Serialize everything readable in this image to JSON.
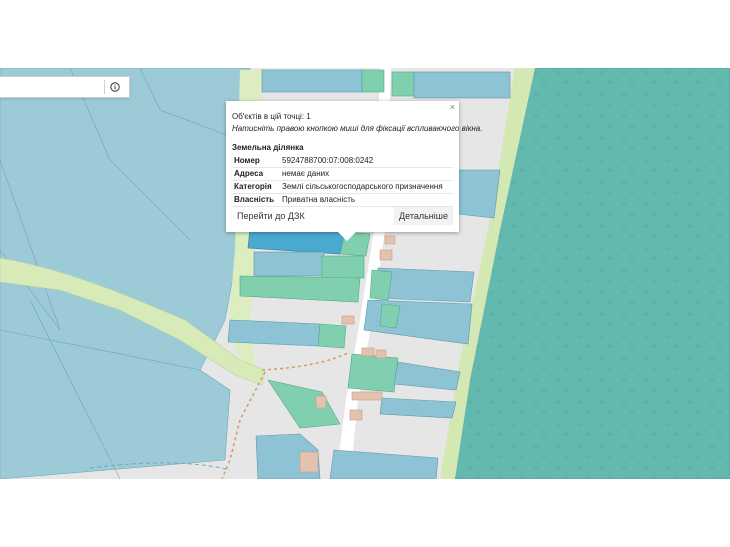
{
  "search": {
    "placeholder": "",
    "info_icon": "info-circle-icon"
  },
  "popup": {
    "objects_line": "Об'єктів в цій точці: 1",
    "hint": "Натисніть правою кнопкою миші для фіксації вспливаючого вікна.",
    "section_title": "Земельна ділянка",
    "rows": [
      {
        "label": "Номер",
        "value": "5924788700:07:008:0242"
      },
      {
        "label": "Адреса",
        "value": "немає даних"
      },
      {
        "label": "Категорія",
        "value": "Землі сільськогосподарського призначення"
      },
      {
        "label": "Власність",
        "value": "Приватна власність"
      }
    ],
    "close_label": "×",
    "btn_dzk": "Перейти до ДЗК",
    "btn_details": "Детальніше"
  },
  "colors": {
    "parcel_blue": "#8ec3d6",
    "parcel_green": "#80d0b0",
    "parcel_selected": "#4aa9cf",
    "forest": "#64b9ae",
    "meadow": "#d7eab7",
    "road": "#ffffff",
    "path": "#c9a56a"
  }
}
